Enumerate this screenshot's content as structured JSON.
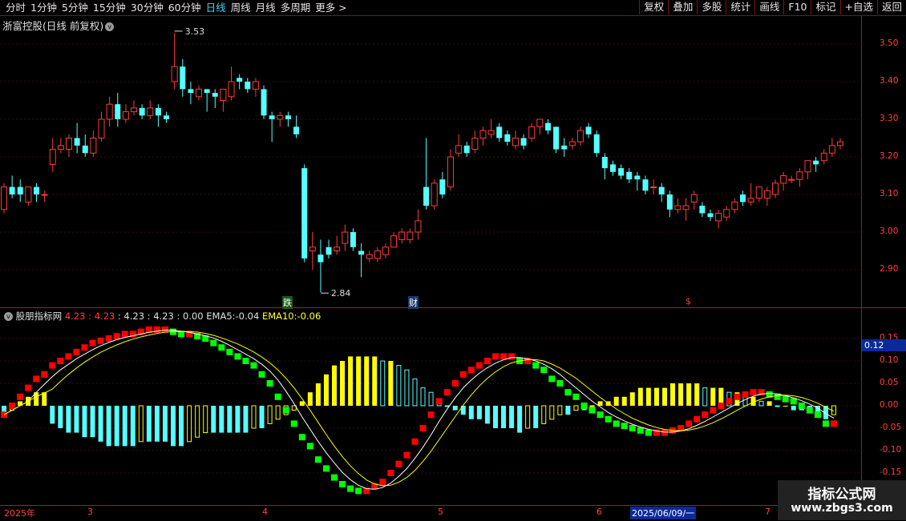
{
  "toolbar": {
    "periods": [
      "分时",
      "1分钟",
      "5分钟",
      "15分钟",
      "30分钟",
      "60分钟",
      "日线",
      "周线",
      "月线",
      "多周期",
      "更多 >"
    ],
    "active_period": "日线",
    "tools": [
      "复权",
      "叠加",
      "多股",
      "统计",
      "画线",
      "F10",
      "标记",
      "+自选",
      "返回"
    ]
  },
  "chart_title": "浙富控股(日线 前复权)",
  "title_circle": "v",
  "indicator": {
    "name": "股朋指标网",
    "v1": "4.23",
    "v1b": "4.23",
    "v2": "4.23",
    "v3": "4.23",
    "v4": "0.00",
    "ema5_label": "EMA5:",
    "ema5": "-0.04",
    "ema10_label": "EMA10:",
    "ema10": "-0.06"
  },
  "price_axis": [
    "3.50",
    "3.40",
    "3.30",
    "3.20",
    "3.10",
    "3.00",
    "2.90"
  ],
  "ind_axis": [
    "0.15",
    "0.10",
    "0.05",
    "0.00",
    "-0.05",
    "-0.10",
    "-0.15"
  ],
  "current_value_tag": "0.12",
  "annotations": {
    "high": "3.53",
    "low": "2.84",
    "mark_die": "跌",
    "mark_cai": "财",
    "mark_s": "$"
  },
  "x_axis": {
    "labels": [
      "2025年",
      "3",
      "4",
      "5",
      "6",
      "2025/06/09/一",
      "7"
    ]
  },
  "watermark": {
    "line1": "指标公式网",
    "line2": "www.zbgs3.com"
  },
  "colors": {
    "up": "#ff3b3b",
    "down": "#54ffff",
    "yellow": "#ffff00",
    "green": "#00ff00",
    "red": "#ff0000",
    "axis": "#b01818"
  },
  "chart_data": {
    "type": "candlestick",
    "ylim": [
      2.8,
      3.56
    ],
    "candles": [
      [
        3.06,
        3.12,
        3.13,
        3.05
      ],
      [
        3.12,
        3.1,
        3.15,
        3.09
      ],
      [
        3.12,
        3.1,
        3.14,
        3.08
      ],
      [
        3.08,
        3.12,
        3.12,
        3.07
      ],
      [
        3.12,
        3.1,
        3.13,
        3.08
      ],
      [
        3.1,
        3.1,
        3.11,
        3.08
      ],
      [
        3.18,
        3.22,
        3.25,
        3.16
      ],
      [
        3.22,
        3.23,
        3.25,
        3.21
      ],
      [
        3.22,
        3.25,
        3.26,
        3.2
      ],
      [
        3.25,
        3.23,
        3.29,
        3.21
      ],
      [
        3.23,
        3.21,
        3.26,
        3.2
      ],
      [
        3.21,
        3.25,
        3.27,
        3.2
      ],
      [
        3.25,
        3.3,
        3.32,
        3.24
      ],
      [
        3.3,
        3.34,
        3.36,
        3.28
      ],
      [
        3.34,
        3.3,
        3.37,
        3.28
      ],
      [
        3.3,
        3.32,
        3.34,
        3.29
      ],
      [
        3.32,
        3.33,
        3.35,
        3.31
      ],
      [
        3.33,
        3.31,
        3.34,
        3.3
      ],
      [
        3.31,
        3.33,
        3.35,
        3.3
      ],
      [
        3.33,
        3.31,
        3.34,
        3.28
      ],
      [
        3.31,
        3.3,
        3.32,
        3.29
      ],
      [
        3.4,
        3.44,
        3.53,
        3.38
      ],
      [
        3.44,
        3.38,
        3.46,
        3.36
      ],
      [
        3.38,
        3.37,
        3.4,
        3.34
      ],
      [
        3.36,
        3.38,
        3.39,
        3.35
      ],
      [
        3.38,
        3.37,
        3.38,
        3.32
      ],
      [
        3.37,
        3.36,
        3.38,
        3.33
      ],
      [
        3.35,
        3.38,
        3.38,
        3.32
      ],
      [
        3.36,
        3.4,
        3.44,
        3.35
      ],
      [
        3.41,
        3.4,
        3.42,
        3.38
      ],
      [
        3.4,
        3.38,
        3.41,
        3.37
      ],
      [
        3.38,
        3.4,
        3.41,
        3.36
      ],
      [
        3.38,
        3.31,
        3.39,
        3.3
      ],
      [
        3.31,
        3.3,
        3.32,
        3.24
      ],
      [
        3.3,
        3.31,
        3.32,
        3.28
      ],
      [
        3.31,
        3.3,
        3.32,
        3.28
      ],
      [
        3.28,
        3.26,
        3.31,
        3.25
      ],
      [
        3.17,
        2.93,
        3.18,
        2.92
      ],
      [
        2.95,
        2.96,
        3.0,
        2.9
      ],
      [
        2.94,
        2.92,
        2.98,
        2.84
      ],
      [
        2.96,
        2.94,
        2.98,
        2.93
      ],
      [
        2.95,
        2.96,
        2.99,
        2.94
      ],
      [
        2.97,
        3.0,
        3.02,
        2.95
      ],
      [
        3.0,
        2.96,
        3.01,
        2.95
      ],
      [
        2.95,
        2.94,
        2.97,
        2.88
      ],
      [
        2.93,
        2.94,
        2.95,
        2.92
      ],
      [
        2.93,
        2.95,
        2.96,
        2.92
      ],
      [
        2.94,
        2.96,
        2.97,
        2.93
      ],
      [
        2.96,
        2.99,
        3.0,
        2.96
      ],
      [
        2.98,
        3.0,
        3.01,
        2.97
      ],
      [
        2.98,
        3.0,
        3.01,
        2.97
      ],
      [
        3.0,
        3.03,
        3.06,
        2.98
      ],
      [
        3.12,
        3.07,
        3.25,
        3.06
      ],
      [
        3.07,
        3.13,
        3.14,
        3.06
      ],
      [
        3.14,
        3.1,
        3.16,
        3.09
      ],
      [
        3.12,
        3.2,
        3.22,
        3.11
      ],
      [
        3.21,
        3.23,
        3.26,
        3.2
      ],
      [
        3.23,
        3.21,
        3.24,
        3.2
      ],
      [
        3.22,
        3.25,
        3.27,
        3.21
      ],
      [
        3.25,
        3.27,
        3.28,
        3.23
      ],
      [
        3.26,
        3.27,
        3.3,
        3.25
      ],
      [
        3.28,
        3.25,
        3.29,
        3.24
      ],
      [
        3.26,
        3.24,
        3.27,
        3.23
      ],
      [
        3.23,
        3.25,
        3.27,
        3.22
      ],
      [
        3.25,
        3.23,
        3.26,
        3.22
      ],
      [
        3.25,
        3.28,
        3.29,
        3.24
      ],
      [
        3.28,
        3.3,
        3.3,
        3.26
      ],
      [
        3.29,
        3.27,
        3.3,
        3.26
      ],
      [
        3.28,
        3.22,
        3.28,
        3.21
      ],
      [
        3.23,
        3.22,
        3.25,
        3.2
      ],
      [
        3.23,
        3.24,
        3.25,
        3.22
      ],
      [
        3.24,
        3.27,
        3.28,
        3.23
      ],
      [
        3.28,
        3.26,
        3.29,
        3.25
      ],
      [
        3.26,
        3.21,
        3.27,
        3.2
      ],
      [
        3.2,
        3.17,
        3.21,
        3.14
      ],
      [
        3.18,
        3.16,
        3.19,
        3.15
      ],
      [
        3.17,
        3.15,
        3.18,
        3.14
      ],
      [
        3.16,
        3.14,
        3.17,
        3.13
      ],
      [
        3.15,
        3.14,
        3.16,
        3.11
      ],
      [
        3.14,
        3.11,
        3.15,
        3.1
      ],
      [
        3.12,
        3.12,
        3.14,
        3.1
      ],
      [
        3.12,
        3.1,
        3.13,
        3.08
      ],
      [
        3.1,
        3.06,
        3.11,
        3.04
      ],
      [
        3.06,
        3.07,
        3.09,
        3.05
      ],
      [
        3.06,
        3.07,
        3.09,
        3.03
      ],
      [
        3.08,
        3.1,
        3.11,
        3.06
      ],
      [
        3.07,
        3.05,
        3.08,
        3.04
      ],
      [
        3.05,
        3.04,
        3.06,
        3.03
      ],
      [
        3.03,
        3.05,
        3.06,
        3.01
      ],
      [
        3.04,
        3.06,
        3.07,
        3.03
      ],
      [
        3.06,
        3.08,
        3.09,
        3.05
      ],
      [
        3.1,
        3.08,
        3.11,
        3.07
      ],
      [
        3.08,
        3.09,
        3.13,
        3.07
      ],
      [
        3.09,
        3.12,
        3.12,
        3.08
      ],
      [
        3.09,
        3.11,
        3.12,
        3.07
      ],
      [
        3.1,
        3.13,
        3.14,
        3.09
      ],
      [
        3.13,
        3.15,
        3.16,
        3.11
      ],
      [
        3.14,
        3.14,
        3.15,
        3.13
      ],
      [
        3.14,
        3.16,
        3.17,
        3.12
      ],
      [
        3.16,
        3.19,
        3.19,
        3.14
      ],
      [
        3.19,
        3.18,
        3.2,
        3.16
      ],
      [
        3.19,
        3.21,
        3.22,
        3.18
      ],
      [
        3.21,
        3.23,
        3.25,
        3.2
      ],
      [
        3.23,
        3.24,
        3.25,
        3.22
      ]
    ],
    "indicator_series": {
      "histogram": [
        -0.02,
        -0.01,
        0.01,
        0.02,
        0.03,
        0.03,
        -0.04,
        -0.05,
        -0.06,
        -0.06,
        -0.07,
        -0.07,
        -0.08,
        -0.09,
        -0.09,
        -0.09,
        -0.09,
        -0.08,
        -0.08,
        -0.08,
        -0.08,
        -0.09,
        -0.09,
        -0.08,
        -0.07,
        -0.06,
        -0.06,
        -0.06,
        -0.06,
        -0.06,
        -0.06,
        -0.05,
        -0.05,
        -0.04,
        -0.03,
        -0.02,
        -0.01,
        0.01,
        0.03,
        0.05,
        0.07,
        0.09,
        0.1,
        0.11,
        0.11,
        0.11,
        0.11,
        0.1,
        0.1,
        0.09,
        0.08,
        0.06,
        0.04,
        0.03,
        0.01,
        0.0,
        -0.01,
        -0.02,
        -0.03,
        -0.03,
        -0.04,
        -0.05,
        -0.05,
        -0.05,
        -0.06,
        -0.05,
        -0.05,
        -0.04,
        -0.03,
        -0.02,
        -0.02,
        -0.01,
        -0.01,
        0.0,
        0.01,
        0.01,
        0.02,
        0.02,
        0.03,
        0.04,
        0.04,
        0.04,
        0.04,
        0.05,
        0.05,
        0.05,
        0.05,
        0.04,
        0.04,
        0.04,
        0.03,
        0.03,
        0.02,
        0.02,
        0.01,
        0.01,
        0.0,
        0.0,
        -0.01,
        -0.01,
        -0.01,
        -0.02,
        -0.03,
        -0.02
      ],
      "ema_a": [
        -0.02,
        0.0,
        0.02,
        0.04,
        0.06,
        0.07,
        0.09,
        0.1,
        0.11,
        0.12,
        0.13,
        0.14,
        0.145,
        0.15,
        0.155,
        0.16,
        0.16,
        0.165,
        0.17,
        0.17,
        0.17,
        0.165,
        0.16,
        0.16,
        0.155,
        0.15,
        0.14,
        0.13,
        0.12,
        0.11,
        0.1,
        0.09,
        0.07,
        0.05,
        0.02,
        -0.01,
        -0.04,
        -0.07,
        -0.09,
        -0.12,
        -0.14,
        -0.16,
        -0.175,
        -0.185,
        -0.19,
        -0.19,
        -0.18,
        -0.17,
        -0.15,
        -0.13,
        -0.11,
        -0.08,
        -0.05,
        -0.02,
        0.01,
        0.03,
        0.05,
        0.07,
        0.08,
        0.09,
        0.1,
        0.11,
        0.11,
        0.11,
        0.1,
        0.1,
        0.09,
        0.08,
        0.06,
        0.05,
        0.03,
        0.02,
        0.0,
        -0.01,
        -0.02,
        -0.03,
        -0.04,
        -0.045,
        -0.05,
        -0.055,
        -0.06,
        -0.06,
        -0.06,
        -0.055,
        -0.05,
        -0.04,
        -0.03,
        -0.02,
        -0.01,
        0.0,
        0.01,
        0.02,
        0.025,
        0.03,
        0.03,
        0.025,
        0.02,
        0.015,
        0.01,
        0.0,
        -0.01,
        -0.02,
        -0.04,
        -0.04
      ]
    }
  }
}
